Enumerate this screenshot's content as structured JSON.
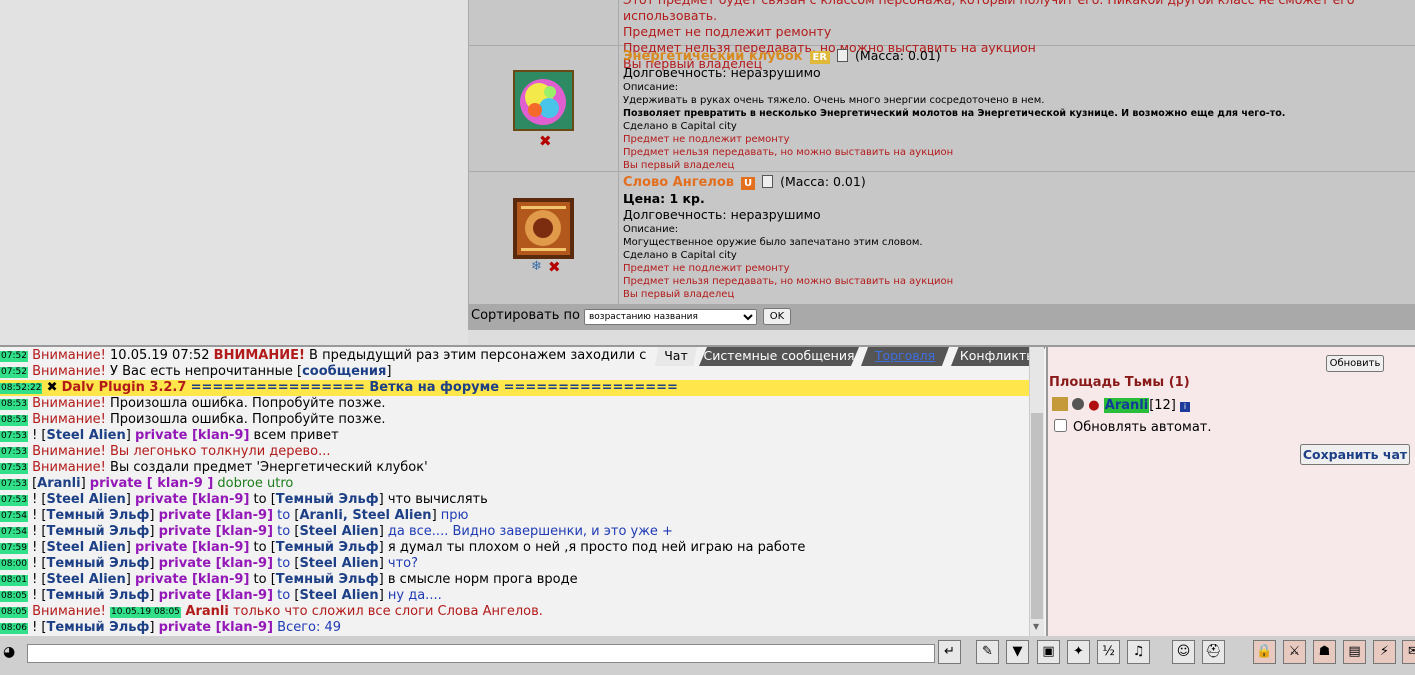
{
  "inventory": {
    "top_partial": {
      "line1": "Этот предмет будет связан с классом персонажа, который получит его. Никакой другой класс не сможет его использовать.",
      "line2": "Предмет не подлежит ремонту",
      "line3": "Предмет нельзя передавать, но можно выставить на аукцион",
      "line4": "Вы первый владелец"
    },
    "item1": {
      "title": "Энергетический клубок",
      "badge": "ER",
      "mass": "(Масса: 0.01)",
      "durability": "Долговечность: неразрушимо",
      "desc_label": "Описание:",
      "desc": "Удерживать в руках очень тяжело. Очень много энергии сосредоточено в нем.",
      "desc_bold": "Позволяет превратить в несколько Энергетический молотов на Энергетической кузнице. И возможно еще для чего-то.",
      "made": "Сделано в Capital city",
      "no_repair": "Предмет не подлежит ремонту",
      "no_transfer": "Предмет нельзя передавать, но можно выставить на аукцион",
      "owner": "Вы первый владелец",
      "icon": "energy-ball-icon",
      "badge_color": "#e0b93a"
    },
    "item2": {
      "title": "Слово Ангелов",
      "badge": "U",
      "mass": "(Масса: 0.01)",
      "price": "Цена: 1 кр.",
      "durability": "Долговечность: неразрушимо",
      "desc_label": "Описание:",
      "desc": "Могущественное оружие было запечатано этим словом.",
      "made": "Сделано в Capital city",
      "no_repair": "Предмет не подлежит ремонту",
      "no_transfer": "Предмет нельзя передавать, но можно выставить на аукцион",
      "owner": "Вы первый владелец",
      "icon": "angel-book-icon",
      "badge_color": "#e36f1e"
    },
    "sort": {
      "label": "Сортировать по",
      "selected": "возрастанию названия",
      "ok": "OK"
    }
  },
  "chat": {
    "tabs": [
      "Чат",
      "Системные сообщения",
      "Торговля",
      "Конфликты"
    ],
    "lines": [
      {
        "ts": "07:52",
        "parts": [
          [
            "red",
            "Внимание!"
          ],
          [
            "plain",
            " 10.05.19 07:52 "
          ],
          [
            "redbold",
            "ВНИМАНИЕ!"
          ],
          [
            "plain",
            " В предыдущий раз этим персонажем заходили с"
          ]
        ]
      },
      {
        "ts": "07:52",
        "parts": [
          [
            "red",
            "Внимание!"
          ],
          [
            "plain",
            " У Вас есть непрочитанные ["
          ],
          [
            "navy",
            "сообщения"
          ],
          [
            "plain",
            "]"
          ]
        ]
      },
      {
        "ts": "08:52:22",
        "parts": [
          [
            "plain",
            " ✖ "
          ],
          [
            "redbold",
            "Dalv Plugin 3.2.7"
          ],
          [
            "plain",
            "   "
          ],
          [
            "navy",
            "================ Ветка на форуме ================"
          ]
        ],
        "highlight": true
      },
      {
        "ts": "08:53",
        "parts": [
          [
            "red",
            "Внимание!"
          ],
          [
            "plain",
            " Произошла ошибка. Попробуйте позже."
          ]
        ]
      },
      {
        "ts": "08:53",
        "parts": [
          [
            "red",
            "Внимание!"
          ],
          [
            "plain",
            " Произошла ошибка. Попробуйте позже."
          ]
        ]
      },
      {
        "ts": "07:53",
        "parts": [
          [
            "plain",
            "! ["
          ],
          [
            "navy",
            "Steel Alien"
          ],
          [
            "plain",
            "] "
          ],
          [
            "purple",
            "private [klan-9]"
          ],
          [
            "plain",
            " всем привет"
          ]
        ]
      },
      {
        "ts": "07:53",
        "parts": [
          [
            "red",
            "Внимание! Вы легонько толкнули дерево..."
          ]
        ]
      },
      {
        "ts": "07:53",
        "parts": [
          [
            "red",
            "Внимание!"
          ],
          [
            "plain",
            " Вы создали предмет 'Энергетический клубок'"
          ]
        ]
      },
      {
        "ts": "07:53",
        "parts": [
          [
            "plain",
            " ["
          ],
          [
            "navy",
            "Aranli"
          ],
          [
            "plain",
            "] "
          ],
          [
            "purple",
            "private [ klan-9 ]"
          ],
          [
            "green",
            " dobroe utro"
          ]
        ]
      },
      {
        "ts": "07:53",
        "parts": [
          [
            "plain",
            "! ["
          ],
          [
            "navy",
            "Steel Alien"
          ],
          [
            "plain",
            "] "
          ],
          [
            "purple",
            "private [klan-9]"
          ],
          [
            "plain",
            " to ["
          ],
          [
            "navy",
            "Темный Эльф"
          ],
          [
            "plain",
            "] что вычислять"
          ]
        ]
      },
      {
        "ts": "07:54",
        "parts": [
          [
            "plain",
            "! ["
          ],
          [
            "navy",
            "Темный Эльф"
          ],
          [
            "plain",
            "] "
          ],
          [
            "purple",
            "private [klan-9]"
          ],
          [
            "blue",
            " to "
          ],
          [
            "plain",
            "["
          ],
          [
            "navy",
            "Aranli, Steel Alien"
          ],
          [
            "plain",
            "] "
          ],
          [
            "blue",
            "прю"
          ]
        ]
      },
      {
        "ts": "07:54",
        "parts": [
          [
            "plain",
            "! ["
          ],
          [
            "navy",
            "Темный Эльф"
          ],
          [
            "plain",
            "] "
          ],
          [
            "purple",
            "private [klan-9]"
          ],
          [
            "blue",
            " to "
          ],
          [
            "plain",
            "["
          ],
          [
            "navy",
            "Steel Alien"
          ],
          [
            "plain",
            "] "
          ],
          [
            "blue",
            "да все.... Видно завершенки, и это уже +"
          ]
        ]
      },
      {
        "ts": "07:59",
        "parts": [
          [
            "plain",
            "! ["
          ],
          [
            "navy",
            "Steel Alien"
          ],
          [
            "plain",
            "] "
          ],
          [
            "purple",
            "private [klan-9]"
          ],
          [
            "plain",
            " to ["
          ],
          [
            "navy",
            "Темный Эльф"
          ],
          [
            "plain",
            "] я думал ты плохом о ней ,я просто под ней играю на работе"
          ]
        ]
      },
      {
        "ts": "08:00",
        "parts": [
          [
            "plain",
            "! ["
          ],
          [
            "navy",
            "Темный Эльф"
          ],
          [
            "plain",
            "] "
          ],
          [
            "purple",
            "private [klan-9]"
          ],
          [
            "blue",
            " to "
          ],
          [
            "plain",
            "["
          ],
          [
            "navy",
            "Steel Alien"
          ],
          [
            "plain",
            "] "
          ],
          [
            "blue",
            "что?"
          ]
        ]
      },
      {
        "ts": "08:01",
        "parts": [
          [
            "plain",
            "! ["
          ],
          [
            "navy",
            "Steel Alien"
          ],
          [
            "plain",
            "] "
          ],
          [
            "purple",
            "private [klan-9]"
          ],
          [
            "plain",
            " to ["
          ],
          [
            "navy",
            "Темный Эльф"
          ],
          [
            "plain",
            "] в смысле норм прога вроде"
          ]
        ]
      },
      {
        "ts": "08:05",
        "parts": [
          [
            "plain",
            "! ["
          ],
          [
            "navy",
            "Темный Эльф"
          ],
          [
            "plain",
            "] "
          ],
          [
            "purple",
            "private [klan-9]"
          ],
          [
            "blue",
            " to "
          ],
          [
            "plain",
            "["
          ],
          [
            "navy",
            "Steel Alien"
          ],
          [
            "plain",
            "] "
          ],
          [
            "blue",
            "ну да...."
          ]
        ]
      },
      {
        "ts": "08:05",
        "parts": [
          [
            "red",
            "Внимание! "
          ],
          [
            "ts",
            "10.05.19 08:05"
          ],
          [
            "redbold",
            " Aranli"
          ],
          [
            "red",
            " только что сложил все слоги Слова Ангелов."
          ]
        ]
      },
      {
        "ts": "08:06",
        "parts": [
          [
            "plain",
            "! ["
          ],
          [
            "navy",
            "Темный Эльф"
          ],
          [
            "plain",
            "] "
          ],
          [
            "purple",
            "private [klan-9]"
          ],
          [
            "blue",
            " Всего: 49"
          ]
        ]
      }
    ]
  },
  "right": {
    "refresh": "Обновить",
    "location": "Площадь Тьмы (1)",
    "player_name": "Aranli",
    "player_level": "[12]",
    "auto_refresh": "Обновлять автомат.",
    "save_chat": "Сохранить чат"
  },
  "toolbar": {
    "icons": [
      "enter-icon",
      "eraser-icon",
      "filter-icon",
      "save-icon",
      "smiley-run-icon",
      "fraction-icon",
      "music-icon",
      "face-icon",
      "helmet-icon",
      "lock-icon",
      "sword-icon",
      "mask-icon",
      "chest-icon",
      "lightning-icon",
      "scroll-icon"
    ]
  }
}
